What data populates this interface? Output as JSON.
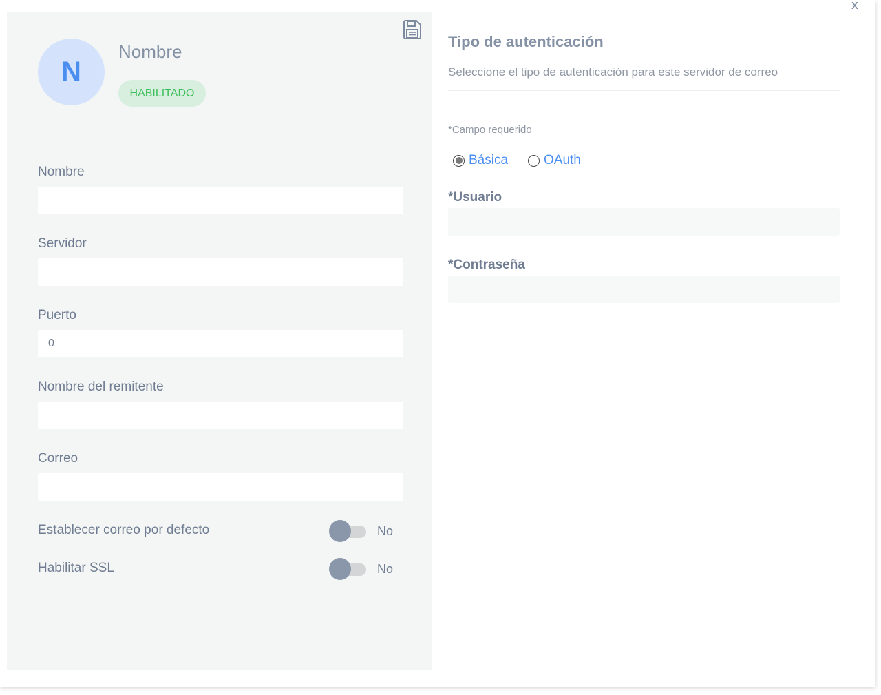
{
  "dialog": {
    "close_label": "x"
  },
  "profile": {
    "avatar_initial": "N",
    "name": "Nombre",
    "status": "HABILITADO",
    "status_color": "#3cbf5a"
  },
  "form": {
    "fields": [
      {
        "label": "Nombre",
        "value": "",
        "placeholder": ""
      },
      {
        "label": "Servidor",
        "value": "",
        "placeholder": ""
      },
      {
        "label": "Puerto",
        "value": "0",
        "placeholder": ""
      },
      {
        "label": "Nombre del remitente",
        "value": "",
        "placeholder": ""
      },
      {
        "label": "Correo",
        "value": "",
        "placeholder": ""
      }
    ],
    "toggles": [
      {
        "label": "Establecer correo por defecto",
        "value": "No",
        "on": false
      },
      {
        "label": "Habilitar SSL",
        "value": "No",
        "on": false
      }
    ]
  },
  "auth": {
    "title": "Tipo de autenticación",
    "subtitle": "Seleccione el tipo de autenticación para este servidor de correo",
    "required_note": "*Campo requerido",
    "options": [
      {
        "label": "Básica",
        "selected": true
      },
      {
        "label": "OAuth",
        "selected": false
      }
    ],
    "user_label": "*Usuario",
    "user_value": "",
    "password_label": "*Contraseña",
    "password_value": ""
  },
  "icons": {
    "save": "save-icon",
    "close": "close-icon"
  },
  "colors": {
    "accent": "#4a8ef0",
    "panel_bg": "#f4f6f5",
    "label": "#6f7c91"
  }
}
